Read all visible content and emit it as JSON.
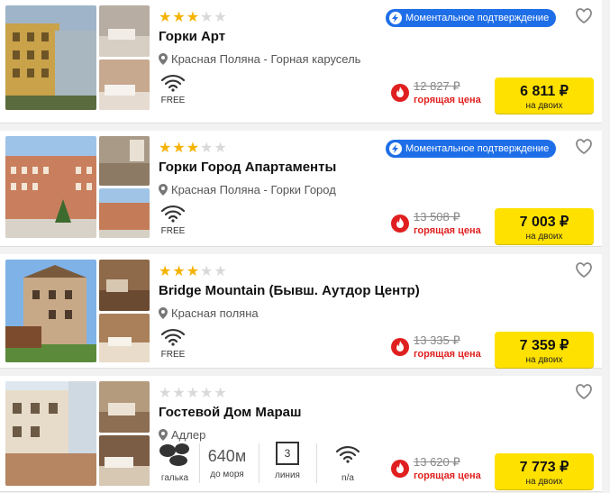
{
  "hotels": [
    {
      "stars": 3,
      "name": "Горки Арт",
      "location": "Красная Поляна - Горная карусель",
      "badge": "Моментальное подтверждение",
      "wifi_label": "FREE",
      "old_price": "12 827 ₽",
      "hot_label": "горящая цена",
      "price": "6 811 ₽",
      "price_sub": "на двоих"
    },
    {
      "stars": 3,
      "name": "Горки Город Апартаменты",
      "location": "Красная Поляна - Горки Город",
      "badge": "Моментальное подтверждение",
      "wifi_label": "FREE",
      "old_price": "13 508 ₽",
      "hot_label": "горящая цена",
      "price": "7 003 ₽",
      "price_sub": "на двоих"
    },
    {
      "stars": 3,
      "name": "Bridge Mountain (Бывш. Аутдор Центр)",
      "location": "Красная поляна",
      "wifi_label": "FREE",
      "old_price": "13 335 ₽",
      "hot_label": "горящая цена",
      "price": "7 359 ₽",
      "price_sub": "на двоих"
    },
    {
      "stars": 0,
      "name": "Гостевой Дом Мараш",
      "location": "Адлер",
      "amenities": {
        "beach": "галька",
        "distance_value": "640м",
        "distance_label": "до моря",
        "line_value": "3",
        "line_label": "линия",
        "wifi_label": "n/a"
      },
      "old_price": "13 620 ₽",
      "hot_label": "горящая цена",
      "price": "7 773 ₽",
      "price_sub": "на двоих"
    }
  ],
  "colors": {
    "accent_blue": "#1e6ee8",
    "price_button": "#ffe100",
    "hot_red": "#e02020",
    "star": "#f5b301"
  }
}
